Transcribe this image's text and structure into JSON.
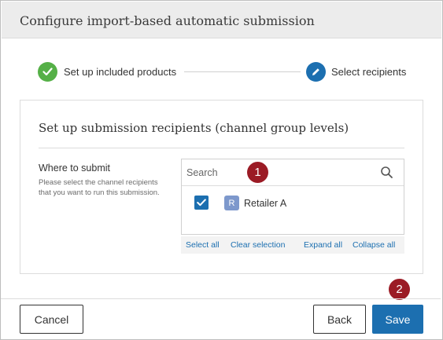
{
  "dialog": {
    "title": "Configure import-based automatic submission"
  },
  "stepper": {
    "steps": [
      {
        "label": "Set up included products",
        "icon": "check-icon",
        "state": "complete",
        "color": "#55b047"
      },
      {
        "label": "Select recipients",
        "icon": "pencil-icon",
        "state": "active",
        "color": "#1c6fb0"
      }
    ]
  },
  "panel": {
    "title": "Set up submission recipients (channel group levels)",
    "where_label": "Where to submit",
    "where_help": "Please select the channel recipients that you want to run this submission."
  },
  "picker": {
    "search_placeholder": "Search",
    "search_icon": "search-icon",
    "options": [
      {
        "avatar": "R",
        "label": "Retailer A",
        "checked": true
      }
    ],
    "actions": {
      "select_all": "Select all",
      "clear_selection": "Clear selection",
      "expand_all": "Expand all",
      "collapse_all": "Collapse all"
    }
  },
  "annotations": {
    "badge1": "1",
    "badge2": "2"
  },
  "footer": {
    "cancel_label": "Cancel",
    "back_label": "Back",
    "save_label": "Save"
  },
  "colors": {
    "accent": "#1c6fb0",
    "success": "#55b047",
    "badge": "#9b1b25"
  }
}
